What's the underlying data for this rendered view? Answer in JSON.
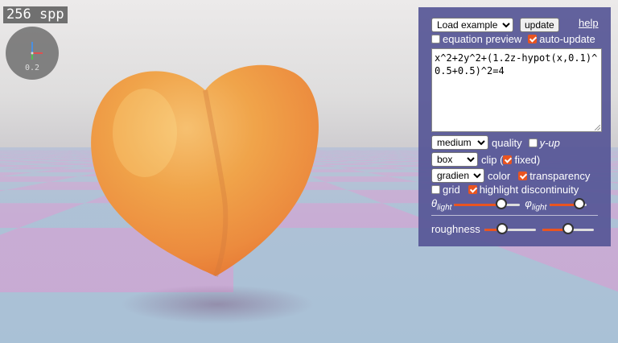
{
  "render": {
    "spp_label": "256 spp",
    "gizmo_scale": "0.2"
  },
  "panel": {
    "load_example": "Load example...",
    "update_label": "update",
    "help_label": "help",
    "equation_preview_label": "equation preview",
    "equation_preview_checked": false,
    "auto_update_label": "auto-update",
    "auto_update_checked": true,
    "equation": "x^2+2y^2+(1.2z-hypot(x,0.1)^0.5+0.5)^2=4",
    "quality_value": "medium",
    "quality_label": "quality",
    "y_up_label": "y-up",
    "y_up_checked": false,
    "clip_value": "box",
    "clip_label_pre": "clip (",
    "fixed_label": "fixed",
    "fixed_checked": true,
    "clip_label_post": ")",
    "color_value": "gradient",
    "color_label": "color",
    "transparency_label": "transparency",
    "transparency_checked": true,
    "grid_label": "grid",
    "grid_checked": false,
    "highlight_label": "highlight discontinuity",
    "highlight_checked": true,
    "theta_symbol": "θ",
    "phi_symbol": "φ",
    "light_sub": "light",
    "theta_light": 0.72,
    "phi_light": 0.8,
    "roughness_label": "roughness",
    "roughness_1": 0.35,
    "roughness_2": 0.5
  },
  "colors": {
    "accent": "#e95420",
    "panel": "#5656a0"
  }
}
